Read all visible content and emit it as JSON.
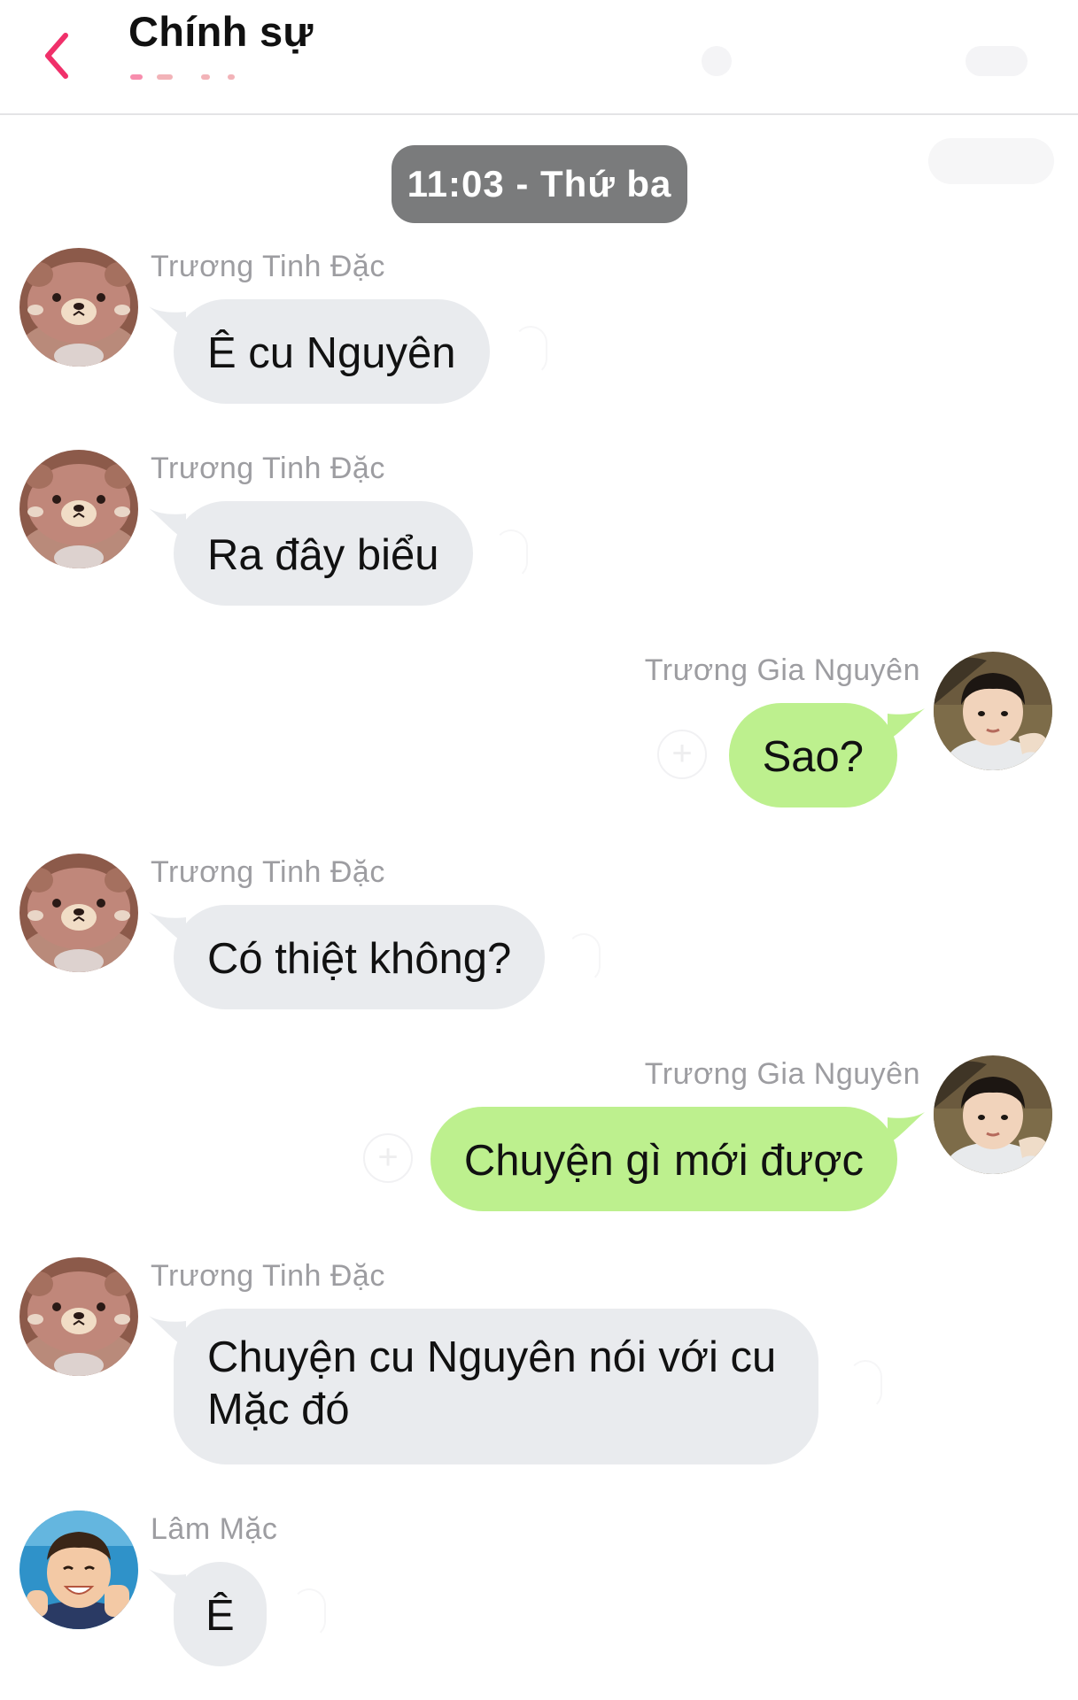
{
  "header": {
    "title": "Chính sự",
    "back_icon": "chevron-left-icon",
    "accent_color": "#f0306a"
  },
  "time_divider": "11:03 - Thứ ba",
  "colors": {
    "incoming_bubble": "#e9ebee",
    "outgoing_bubble": "#bdf08e",
    "time_pill": "#7a7b7c",
    "sender_name": "#9d9da1"
  },
  "messages": [
    {
      "sender": "Trương Tinh Đặc",
      "text": "Ê cu Nguyên",
      "direction": "incoming",
      "avatar": "bear-avatar-icon"
    },
    {
      "sender": "Trương Tinh Đặc",
      "text": "Ra đây biểu",
      "direction": "incoming",
      "avatar": "bear-avatar-icon"
    },
    {
      "sender": "Trương Gia Nguyên",
      "text": "Sao?",
      "direction": "outgoing",
      "avatar": "boy-avatar-icon"
    },
    {
      "sender": "Trương Tinh Đặc",
      "text": "Có thiệt không?",
      "direction": "incoming",
      "avatar": "bear-avatar-icon"
    },
    {
      "sender": "Trương Gia Nguyên",
      "text": "Chuyện gì mới được",
      "direction": "outgoing",
      "avatar": "boy-avatar-icon"
    },
    {
      "sender": "Trương Tinh Đặc",
      "text": "Chuyện cu Nguyên nói với cu Mặc đó",
      "direction": "incoming",
      "avatar": "bear-avatar-icon"
    },
    {
      "sender": "Lâm Mặc",
      "text": "Ê",
      "direction": "incoming",
      "avatar": "smiling-boy-avatar-icon"
    }
  ]
}
